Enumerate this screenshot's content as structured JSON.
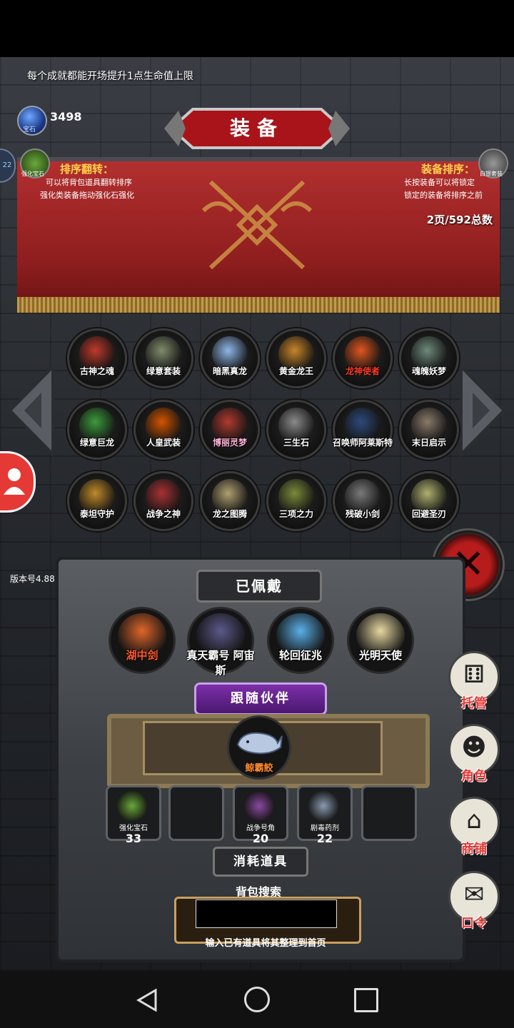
{
  "tip": "每个成就都能开场提升1点生命值上限",
  "gems": {
    "count": "3498",
    "label": "宝石"
  },
  "left_stub": "22",
  "banner": {
    "title": "装备",
    "left_slot_label": "强化宝石",
    "right_slot_label": "白银套装",
    "sort_flip": {
      "title": "排序翻转：",
      "line1": "可以将背包道具翻转排序",
      "line2": "强化类装备拖动强化石强化"
    },
    "sort_equip": {
      "title": "装备排序：",
      "line1": "长按装备可以将锁定",
      "line2": "锁定的装备将排序之前"
    },
    "page_info": "2页/592总数"
  },
  "items": [
    {
      "label": "古神之魂",
      "style": "",
      "color": "#c0392b"
    },
    {
      "label": "绿意套装",
      "style": "",
      "color": "#7f8c6a"
    },
    {
      "label": "暗黑真龙",
      "style": "",
      "color": "#8fb8e8"
    },
    {
      "label": "黄金龙王",
      "style": "",
      "color": "#c9862a"
    },
    {
      "label": "龙神使者",
      "style": "red",
      "color": "#e0561f"
    },
    {
      "label": "魂魄妖梦",
      "style": "",
      "color": "#6d8a7a"
    },
    {
      "label": "绿意巨龙",
      "style": "",
      "color": "#3c9a3c"
    },
    {
      "label": "人皇武装",
      "style": "",
      "color": "#d35400"
    },
    {
      "label": "博丽灵梦",
      "style": "pink",
      "color": "#b03a2e"
    },
    {
      "label": "三生石",
      "style": "",
      "color": "#8a8a8a"
    },
    {
      "label": "召唤师阿莱斯特",
      "style": "",
      "color": "#2e4a7a"
    },
    {
      "label": "末日启示",
      "style": "",
      "color": "#8a7a6a"
    },
    {
      "label": "泰坦守护",
      "style": "",
      "color": "#c08a2a"
    },
    {
      "label": "战争之神",
      "style": "",
      "color": "#a83232"
    },
    {
      "label": "龙之图腾",
      "style": "",
      "color": "#b0a070"
    },
    {
      "label": "三项之力",
      "style": "",
      "color": "#7a8a3a"
    },
    {
      "label": "残破小剑",
      "style": "",
      "color": "#7a7a7a"
    },
    {
      "label": "回避圣刃",
      "style": "",
      "color": "#b0b070"
    }
  ],
  "version": "版本号4.88",
  "equipped": {
    "title": "已佩戴",
    "items": [
      {
        "label": "湖中剑",
        "style": "red",
        "color": "#e0662a"
      },
      {
        "label": "真天霸号 阿宙斯",
        "style": "",
        "color": "#5a5a8a"
      },
      {
        "label": "轮回征兆",
        "style": "",
        "color": "#5ab0e8"
      },
      {
        "label": "光明天使",
        "style": "",
        "color": "#e8d8a0"
      }
    ]
  },
  "companion": {
    "title": "跟随伙伴",
    "name": "鲸霸鲛"
  },
  "consumables": {
    "title": "消耗道具",
    "slots": [
      {
        "name": "强化宝石",
        "count": "33",
        "color": "#6aa83a"
      },
      {
        "name": "",
        "count": "",
        "color": ""
      },
      {
        "name": "战争号角",
        "count": "20",
        "color": "#8a4aa0"
      },
      {
        "name": "剧毒药剂",
        "count": "22",
        "color": "#8a9ab0"
      },
      {
        "name": "",
        "count": "",
        "color": ""
      }
    ]
  },
  "search": {
    "label": "背包搜索",
    "value": "",
    "hint": "输入已有道具将其整理到首页"
  },
  "side_menu": [
    "托管",
    "角色",
    "商铺",
    "口令"
  ]
}
